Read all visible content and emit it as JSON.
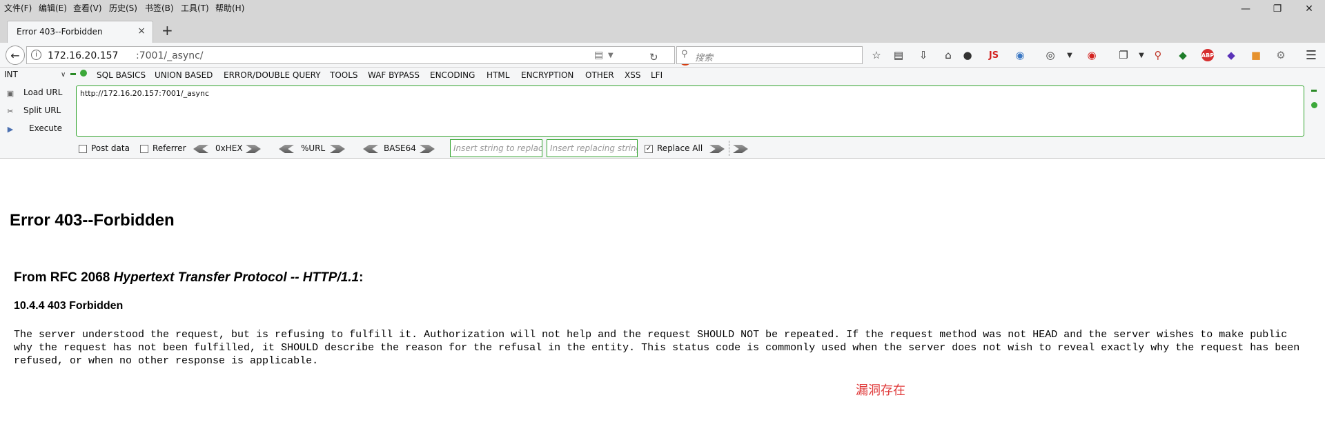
{
  "menubar": {
    "items": [
      "文件(F)",
      "编辑(E)",
      "查看(V)",
      "历史(S)",
      "书签(B)",
      "工具(T)",
      "帮助(H)"
    ]
  },
  "tab": {
    "title": "Error 403--Forbidden",
    "close": "×",
    "new_tab": "+"
  },
  "navbar": {
    "url_host": "172.16.20.157",
    "url_rest": ":7001/_async/",
    "search_placeholder": "搜索",
    "js_label": "JS",
    "abp_label": "ABP"
  },
  "hackbar": {
    "select_value": "INT",
    "menus": [
      "SQL BASICS",
      "UNION BASED",
      "ERROR/DOUBLE QUERY",
      "TOOLS",
      "WAF BYPASS",
      "ENCODING",
      "HTML",
      "ENCRYPTION",
      "OTHER",
      "XSS",
      "LFI"
    ],
    "load_url": "Load URL",
    "split_url": "Split URL",
    "execute": "Execute",
    "textarea_value": "http://172.16.20.157:7001/_async",
    "post_data": "Post data",
    "referrer": "Referrer",
    "hex": "0xHEX",
    "url_enc": "%URL",
    "base64": "BASE64",
    "insert_replace_placeholder": "Insert string to replace",
    "insert_replacing_placeholder": "Insert replacing string",
    "replace_all": "Replace All",
    "replace_all_checked": true
  },
  "page": {
    "title": "Error 403--Forbidden",
    "rfc_prefix": "From RFC 2068 ",
    "rfc_em": "Hypertext Transfer Protocol -- HTTP/1.1",
    "rfc_suffix": ":",
    "section": "10.4.4 403 Forbidden",
    "body": "The server understood the request, but is refusing to fulfill it. Authorization will not help and the request SHOULD NOT be repeated. If the request method was not HEAD and the server wishes to make public why the request has not been fulfilled, it SHOULD describe the reason for the refusal in the entity. This status code is commonly used when the server does not wish to reveal exactly why the request has been refused, or when no other response is applicable.",
    "note": "漏洞存在"
  },
  "colors": {
    "accent_green": "#2fa32b",
    "note_red": "#e03b3b",
    "chrome_gray": "#d6d6d6"
  }
}
